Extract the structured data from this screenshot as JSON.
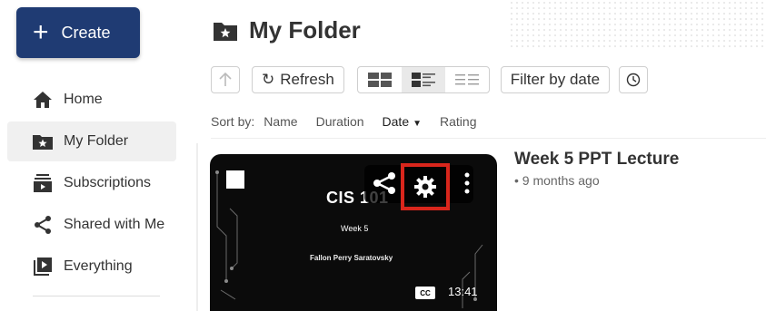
{
  "sidebar": {
    "create_label": "Create",
    "items": [
      {
        "label": "Home",
        "icon": "home-icon"
      },
      {
        "label": "My Folder",
        "icon": "folder-star-icon",
        "active": true
      },
      {
        "label": "Subscriptions",
        "icon": "subscriptions-icon"
      },
      {
        "label": "Shared with Me",
        "icon": "share-icon"
      },
      {
        "label": "Everything",
        "icon": "play-library-icon"
      }
    ]
  },
  "header": {
    "title": "My Folder",
    "icon": "folder-star-icon"
  },
  "toolbar": {
    "refresh_label": "Refresh",
    "filter_label": "Filter by date",
    "view_modes": [
      "grid-view-icon",
      "detail-list-view-icon",
      "compact-list-view-icon"
    ],
    "selected_view": 1
  },
  "sort": {
    "label": "Sort by:",
    "options": [
      "Name",
      "Duration",
      "Date",
      "Rating"
    ],
    "active": "Date"
  },
  "video": {
    "title": "Week 5 PPT Lecture",
    "meta": "• 9 months ago",
    "duration": "13:41",
    "cc_label": "CC",
    "thumb_title": "CIS 101",
    "thumb_week": "Week 5",
    "thumb_author": "Fallon Perry Saratovsky"
  },
  "colors": {
    "create_bg": "#1f3b73",
    "highlight_border": "#d9261c",
    "active_nav_bg": "#f0f0f0"
  }
}
